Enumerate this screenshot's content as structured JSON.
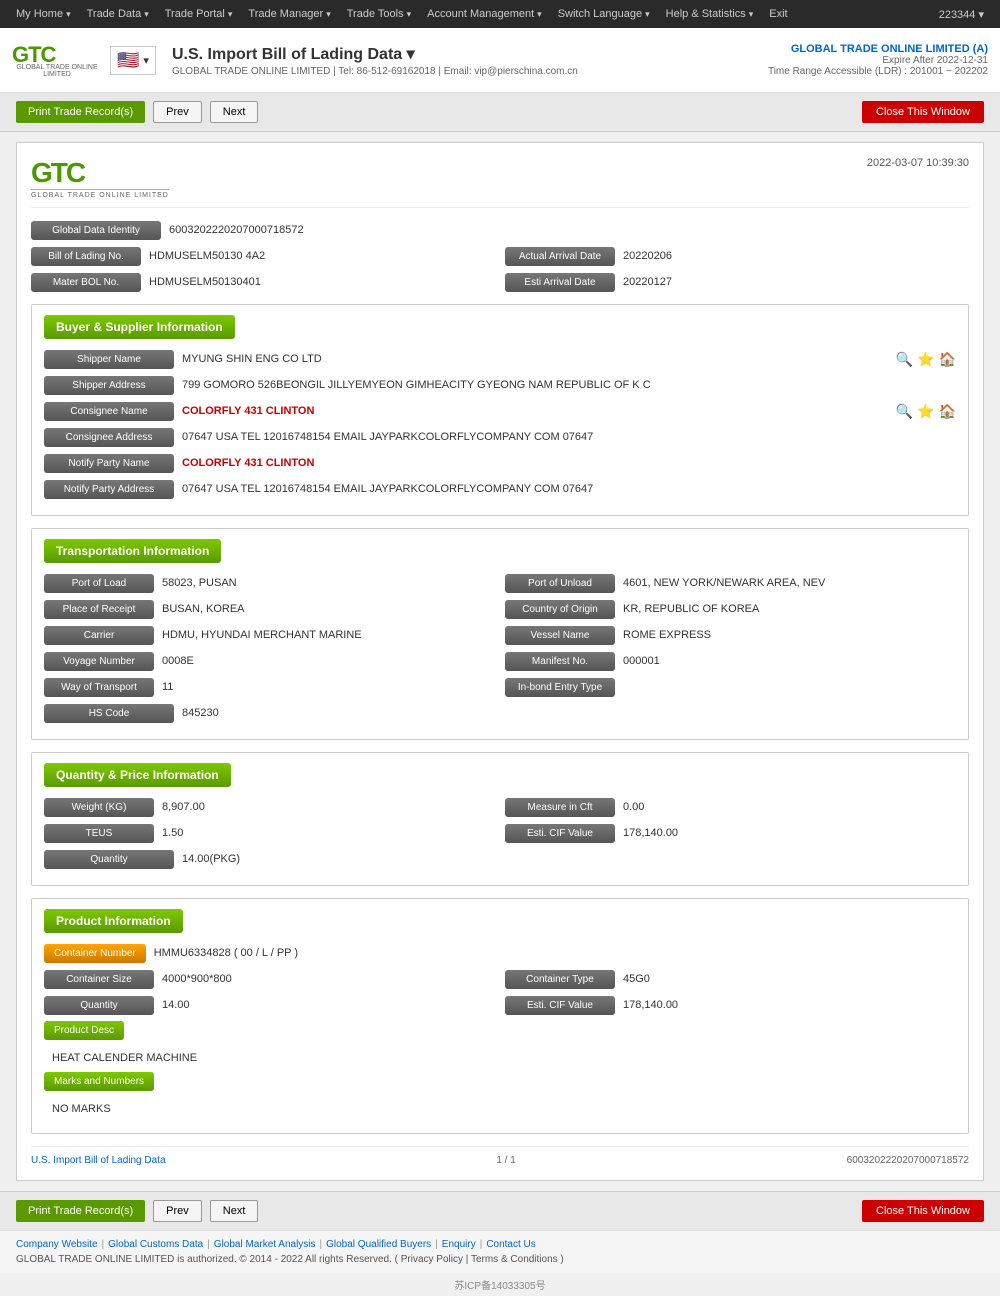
{
  "nav": {
    "items": [
      {
        "label": "My Home",
        "hasDropdown": true
      },
      {
        "label": "Trade Data",
        "hasDropdown": true
      },
      {
        "label": "Trade Portal",
        "hasDropdown": true
      },
      {
        "label": "Trade Manager",
        "hasDropdown": true
      },
      {
        "label": "Trade Tools",
        "hasDropdown": true
      },
      {
        "label": "Account Management",
        "hasDropdown": true
      },
      {
        "label": "Switch Language",
        "hasDropdown": true
      },
      {
        "label": "Help & Statistics",
        "hasDropdown": true
      },
      {
        "label": "Exit",
        "hasDropdown": false
      }
    ],
    "account_id": "223344 ▾"
  },
  "header": {
    "logo_text": "GTC",
    "logo_sub": "GLOBAL TRADE ONLINE LIMITED",
    "flag": "🇺🇸",
    "title": "U.S. Import Bill of Lading Data ▾",
    "subtitle": "GLOBAL TRADE ONLINE LIMITED | Tel: 86-512-69162018 | Email: vip@pierschina.com.cn",
    "company_name": "GLOBAL TRADE ONLINE LIMITED (A)",
    "expire": "Expire After 2022-12-31",
    "time_range": "Time Range Accessible (LDR) : 201001 ~ 202202"
  },
  "toolbar": {
    "print_label": "Print Trade Record(s)",
    "prev_label": "Prev",
    "next_label": "Next",
    "close_label": "Close This Window"
  },
  "record": {
    "timestamp": "2022-03-07 10:39:30",
    "global_data_identity_label": "Global Data Identity",
    "global_data_identity_value": "6003202220207000718572",
    "bill_of_lading_label": "Bill of Lading No.",
    "bill_of_lading_value": "HDMUSELM50130 4A2",
    "actual_arrival_date_label": "Actual Arrival Date",
    "actual_arrival_date_value": "20220206",
    "mater_bol_label": "Mater BOL No.",
    "mater_bol_value": "HDMUSELM50130401",
    "esti_arrival_label": "Esti Arrival Date",
    "esti_arrival_value": "20220127"
  },
  "buyer_supplier": {
    "section_title": "Buyer & Supplier Information",
    "shipper_name_label": "Shipper Name",
    "shipper_name_value": "MYUNG SHIN ENG CO LTD",
    "shipper_address_label": "Shipper Address",
    "shipper_address_value": "799 GOMORO 526BEONGIL JILLYEMYEON GIMHEACITY GYEONG NAM REPUBLIC OF K C",
    "consignee_name_label": "Consignee Name",
    "consignee_name_value": "COLORFLY 431 CLINTON",
    "consignee_address_label": "Consignee Address",
    "consignee_address_value": "07647 USA TEL 12016748154 EMAIL JAYPARKCOLORFLYCOMPANY COM 07647",
    "notify_party_name_label": "Notify Party Name",
    "notify_party_name_value": "COLORFLY 431 CLINTON",
    "notify_party_address_label": "Notify Party Address",
    "notify_party_address_value": "07647 USA TEL 12016748154 EMAIL JAYPARKCOLORFLYCOMPANY COM 07647"
  },
  "transportation": {
    "section_title": "Transportation Information",
    "port_of_load_label": "Port of Load",
    "port_of_load_value": "58023, PUSAN",
    "port_of_unload_label": "Port of Unload",
    "port_of_unload_value": "4601, NEW YORK/NEWARK AREA, NEV",
    "place_of_receipt_label": "Place of Receipt",
    "place_of_receipt_value": "BUSAN, KOREA",
    "country_of_origin_label": "Country of Origin",
    "country_of_origin_value": "KR, REPUBLIC OF KOREA",
    "carrier_label": "Carrier",
    "carrier_value": "HDMU, HYUNDAI MERCHANT MARINE",
    "vessel_name_label": "Vessel Name",
    "vessel_name_value": "ROME EXPRESS",
    "voyage_number_label": "Voyage Number",
    "voyage_number_value": "0008E",
    "manifest_no_label": "Manifest No.",
    "manifest_no_value": "000001",
    "way_of_transport_label": "Way of Transport",
    "way_of_transport_value": "11",
    "in_bond_entry_label": "In-bond Entry Type",
    "in_bond_entry_value": "",
    "hs_code_label": "HS Code",
    "hs_code_value": "845230"
  },
  "quantity_price": {
    "section_title": "Quantity & Price Information",
    "weight_label": "Weight (KG)",
    "weight_value": "8,907.00",
    "measure_in_cft_label": "Measure in Cft",
    "measure_in_cft_value": "0.00",
    "teus_label": "TEUS",
    "teus_value": "1.50",
    "esti_cif_label": "Esti. CIF Value",
    "esti_cif_value": "178,140.00",
    "quantity_label": "Quantity",
    "quantity_value": "14.00(PKG)"
  },
  "product_info": {
    "section_title": "Product Information",
    "container_number_label": "Container Number",
    "container_number_value": "HMMU6334828 ( 00 / L / PP )",
    "container_size_label": "Container Size",
    "container_size_value": "4000*900*800",
    "container_type_label": "Container Type",
    "container_type_value": "45G0",
    "quantity_label": "Quantity",
    "quantity_value": "14.00",
    "esti_cif_label": "Esti. CIF Value",
    "esti_cif_value": "178,140.00",
    "product_desc_label": "Product Desc",
    "product_desc_value": "HEAT CALENDER MACHINE",
    "marks_label": "Marks and Numbers",
    "marks_value": "NO MARKS"
  },
  "record_footer": {
    "link_text": "U.S. Import Bill of Lading Data",
    "page_info": "1 / 1",
    "record_id": "6003202220207000718572"
  },
  "bottom_toolbar": {
    "print_label": "Print Trade Record(s)",
    "prev_label": "Prev",
    "next_label": "Next",
    "close_label": "Close This Window"
  },
  "footer": {
    "links": [
      "Company Website",
      "Global Customs Data",
      "Global Market Analysis",
      "Global Qualified Buyers",
      "Enquiry",
      "Contact Us"
    ],
    "copyright": "GLOBAL TRADE ONLINE LIMITED is authorized. © 2014 - 2022 All rights Reserved.  (  Privacy Policy  |  Terms & Conditions  )",
    "icp": "苏ICP备14033305号"
  }
}
